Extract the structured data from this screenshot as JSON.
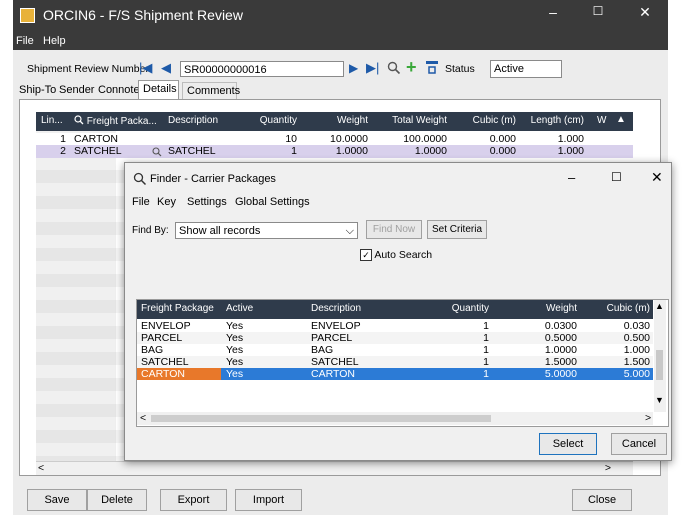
{
  "main_window": {
    "title": "ORCIN6 - F/S Shipment Review",
    "menu": [
      "File",
      "Help"
    ],
    "controls": {
      "minimize": "–",
      "maximize": "☐",
      "close": "✕"
    },
    "review_number_label": "Shipment Review Number",
    "review_number_value": "SR00000000016",
    "status_label": "Status",
    "status_value": "Active",
    "tabs": [
      "Ship-To",
      "Sender",
      "Connote",
      "Details",
      "Comments"
    ],
    "active_tab": "Details",
    "grid": {
      "headers": [
        "Lin...",
        "Freight Packa...",
        "Description",
        "Quantity",
        "Weight",
        "Total Weight",
        "Cubic (m)",
        "Length (cm)",
        "W"
      ],
      "rows": [
        [
          "1",
          "CARTON",
          "",
          "10",
          "10.0000",
          "100.0000",
          "0.000",
          "1.000"
        ],
        [
          "2",
          "SATCHEL",
          "SATCHEL",
          "1",
          "1.0000",
          "1.0000",
          "0.000",
          "1.000"
        ]
      ]
    },
    "buttons": {
      "save": "Save",
      "delete": "Delete",
      "export": "Export",
      "import": "Import",
      "close": "Close"
    }
  },
  "finder": {
    "title": "Finder - Carrier Packages",
    "menu": [
      "File",
      "Key",
      "Settings",
      "Global Settings"
    ],
    "find_by_label": "Find By:",
    "find_by_value": "Show all records",
    "find_now": "Find Now",
    "set_criteria": "Set Criteria",
    "auto_search_label": "Auto Search",
    "auto_search_checked": "✓",
    "headers": [
      "Freight Package",
      "Active",
      "Description",
      "Quantity",
      "Weight",
      "Cubic (m)"
    ],
    "rows": [
      [
        "ENVELOP",
        "Yes",
        "ENVELOP",
        "1",
        "0.0300",
        "0.030"
      ],
      [
        "PARCEL",
        "Yes",
        "PARCEL",
        "1",
        "0.5000",
        "0.500"
      ],
      [
        "BAG",
        "Yes",
        "BAG",
        "1",
        "1.0000",
        "1.000"
      ],
      [
        "SATCHEL",
        "Yes",
        "SATCHEL",
        "1",
        "1.5000",
        "1.500"
      ],
      [
        "CARTON",
        "Yes",
        "CARTON",
        "1",
        "5.0000",
        "5.000"
      ]
    ],
    "selected_row": 4,
    "select_button": "Select",
    "cancel_button": "Cancel"
  }
}
